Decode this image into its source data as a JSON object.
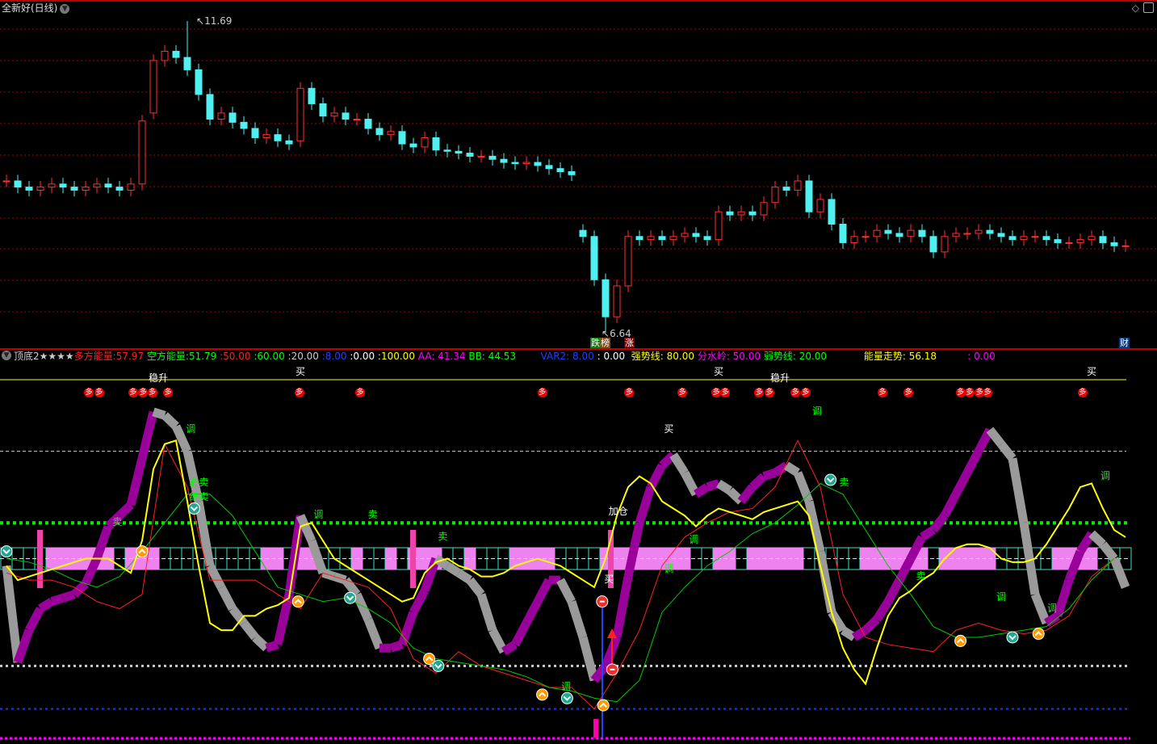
{
  "window": {
    "title": "全新好(日线)",
    "icons": [
      "chevron-down-icon",
      "diamond-icon",
      "panel-toggle-icon"
    ]
  },
  "price_panel": {
    "max_label": "11.69",
    "min_label": "6.64",
    "badges": [
      {
        "text": "跌",
        "color": "#1a7a1a"
      },
      {
        "text": "榜",
        "color": "#8a4a10"
      },
      {
        "text": "涨",
        "color": "#7a0000"
      }
    ],
    "fin_badge": "财"
  },
  "indicator_header": {
    "name": "顶底2★★★★",
    "items": [
      {
        "text": "多方能量:",
        "color": "#ff2020"
      },
      {
        "text": "57.97",
        "color": "#ff2020"
      },
      {
        "text": " 空方能量:",
        "color": "#00ff00"
      },
      {
        "text": "51.79",
        "color": "#00ff00"
      },
      {
        "text": " :50.00",
        "color": "#ff2020"
      },
      {
        "text": " :60.00",
        "color": "#00ff00"
      },
      {
        "text": " :20.00",
        "color": "#cccccc"
      },
      {
        "text": " :8.00",
        "color": "#2040ff"
      },
      {
        "text": " :0.00",
        "color": "#ffffff"
      },
      {
        "text": " :100.00",
        "color": "#ffff00"
      },
      {
        "text": " AA: 41.34",
        "color": "#ff00ff"
      },
      {
        "text": " BB: 44.53",
        "color": "#00ff00"
      },
      {
        "text": "        VAR2: 8.00",
        "color": "#2040ff"
      },
      {
        "text": " : 0.00",
        "color": "#ffffff"
      },
      {
        "text": "  强势线: 80.00",
        "color": "#ffff00"
      },
      {
        "text": " 分水岭: 50.00",
        "color": "#ff00ff"
      },
      {
        "text": " 弱势线: 20.00",
        "color": "#00ff00"
      },
      {
        "text": "            能量走势: 56.18",
        "color": "#ffff00"
      },
      {
        "text": "          : 0.00",
        "color": "#ff00ff"
      }
    ]
  },
  "signals": {
    "top_labels": [
      {
        "text": "稳升",
        "i": 13
      },
      {
        "text": "买",
        "i": 26
      },
      {
        "text": "买",
        "i": 63
      },
      {
        "text": "稳升",
        "i": 68
      },
      {
        "text": "买",
        "i": 96
      }
    ],
    "duo_label": "多",
    "duo_positions": [
      7.3,
      8.2,
      11.2,
      12.1,
      12.9,
      14.3,
      25.9,
      31.3,
      47.4,
      55.1,
      59.8,
      62.8,
      63.6,
      66.6,
      67.5,
      69.8,
      70.7,
      77.5,
      79.8,
      84.4,
      85.2,
      86.1,
      86.8,
      95.2
    ],
    "text_labels": [
      {
        "text": "调",
        "i": 16.3,
        "v": 86,
        "color": "#00ff00"
      },
      {
        "text": "必卖",
        "i": 16.6,
        "v": 71,
        "color": "#00ff00"
      },
      {
        "text": "绝卖",
        "i": 16.6,
        "v": 67,
        "color": "#00ff00"
      },
      {
        "text": "卖",
        "i": 9.8,
        "v": 60,
        "color": "#00ff00"
      },
      {
        "text": "调",
        "i": 27.6,
        "v": 62,
        "color": "#00ff00"
      },
      {
        "text": "卖",
        "i": 32.4,
        "v": 62,
        "color": "#00ff00"
      },
      {
        "text": "卖",
        "i": 38.6,
        "v": 56,
        "color": "#00ff00"
      },
      {
        "text": "买",
        "i": 58.6,
        "v": 86,
        "color": "#ffffff"
      },
      {
        "text": "加仓",
        "i": 53.7,
        "v": 63,
        "color": "#ffffff"
      },
      {
        "text": "买",
        "i": 53.3,
        "v": 44,
        "color": "#ffffff"
      },
      {
        "text": "调",
        "i": 60.8,
        "v": 55,
        "color": "#00ff00"
      },
      {
        "text": "调",
        "i": 58.6,
        "v": 47,
        "color": "#00ff00"
      },
      {
        "text": "调",
        "i": 71.7,
        "v": 91,
        "color": "#00ff00"
      },
      {
        "text": "卖",
        "i": 74.1,
        "v": 71,
        "color": "#00ff00"
      },
      {
        "text": "卖",
        "i": 80.9,
        "v": 45,
        "color": "#00ff00"
      },
      {
        "text": "调",
        "i": 88,
        "v": 39,
        "color": "#00ff00"
      },
      {
        "text": "调",
        "i": 92.5,
        "v": 36,
        "color": "#00ff00"
      },
      {
        "text": "调",
        "i": 97.2,
        "v": 73,
        "color": "#00ff00"
      },
      {
        "text": "调",
        "i": 49.5,
        "v": 14,
        "color": "#00ff00"
      }
    ]
  },
  "colors": {
    "up": "#ff3030",
    "down": "#50f0f0",
    "grid": "#b00000",
    "yellow": "#ffff00",
    "purple": "#9a009a",
    "gray": "#9a9a9a",
    "pink": "#ee82ee",
    "teal": "#40e0c0"
  },
  "chart_data": [
    {
      "type": "candlestick",
      "title": "全新好(日线)",
      "closes": [
        9.1,
        9.0,
        8.95,
        9.0,
        9.05,
        9.0,
        8.95,
        9.0,
        9.05,
        9.0,
        8.95,
        9.05,
        10.07,
        11.05,
        11.2,
        11.1,
        10.9,
        10.5,
        10.1,
        10.2,
        10.05,
        9.95,
        9.8,
        9.85,
        9.75,
        9.7,
        10.6,
        10.35,
        10.15,
        10.2,
        10.1,
        10.1,
        9.95,
        9.85,
        9.9,
        9.7,
        9.65,
        9.8,
        9.6,
        9.58,
        9.55,
        9.5,
        9.5,
        9.45,
        9.4,
        9.38,
        9.4,
        9.35,
        9.3,
        9.25,
        9.2,
        8.2,
        7.5,
        6.9,
        7.4,
        8.2,
        8.15,
        8.2,
        8.15,
        8.2,
        8.25,
        8.2,
        8.15,
        8.6,
        8.55,
        8.6,
        8.55,
        8.75,
        9.0,
        8.95,
        9.1,
        8.6,
        8.8,
        8.4,
        8.1,
        8.2,
        8.2,
        8.3,
        8.25,
        8.2,
        8.3,
        8.2,
        7.95,
        8.2,
        8.25,
        8.25,
        8.3,
        8.25,
        8.2,
        8.15,
        8.2,
        8.2,
        8.15,
        8.1,
        8.1,
        8.15,
        8.2,
        8.1,
        8.05,
        8.05
      ],
      "max": {
        "value": 11.69,
        "index": 16
      },
      "min": {
        "value": 6.64,
        "index": 53
      },
      "ylim": [
        6.5,
        11.85
      ]
    },
    {
      "type": "line",
      "title": "顶底2",
      "ylim": [
        0,
        100
      ],
      "reference_lines": [
        {
          "name": "强势线",
          "value": 80
        },
        {
          "name": "分水岭",
          "value": 60
        },
        {
          "name": "中线",
          "value": 50
        },
        {
          "name": "弱势线",
          "value": 20
        },
        {
          "name": "VAR2",
          "value": 8
        },
        {
          "name": "零线",
          "value": 0
        },
        {
          "name": "顶线",
          "value": 100
        }
      ],
      "series": [
        {
          "name": "能量走势",
          "color": "#ffff00",
          "values": [
            48,
            44,
            45,
            46,
            47,
            48,
            49,
            50,
            50,
            50,
            48,
            46,
            55,
            75,
            82,
            83,
            66,
            48,
            32,
            30,
            30,
            34,
            34,
            36,
            37,
            39,
            59,
            60,
            55,
            50,
            48,
            46,
            44,
            42,
            40,
            38,
            39,
            46,
            49,
            50,
            48,
            47,
            45,
            45,
            46,
            48,
            49,
            50,
            49,
            48,
            46,
            44,
            42,
            50,
            62,
            70,
            73,
            71,
            66,
            64,
            62,
            59,
            62,
            64,
            63,
            62,
            61,
            63,
            64,
            65,
            66,
            62,
            48,
            35,
            25,
            19,
            15,
            25,
            34,
            39,
            41,
            44,
            46,
            50,
            53,
            54,
            54,
            53,
            50,
            49,
            49,
            50,
            54,
            59,
            64,
            70,
            71,
            64,
            58,
            56
          ]
        },
        {
          "name": "多空带",
          "color": "#9a9a9a",
          "values": [
            48,
            21,
            30,
            36,
            38,
            39,
            40,
            43,
            50,
            59,
            62,
            65,
            78,
            91,
            90,
            87,
            80,
            66,
            48,
            42,
            36,
            32,
            28,
            25,
            26,
            40,
            62,
            55,
            46,
            45,
            44,
            40,
            33,
            25,
            25,
            26,
            35,
            41,
            50,
            48,
            46,
            44,
            40,
            30,
            24,
            26,
            32,
            38,
            44,
            44,
            38,
            28,
            16,
            20,
            28,
            45,
            60,
            70,
            76,
            79,
            74,
            68,
            70,
            71,
            69,
            66,
            70,
            73,
            74,
            76,
            74,
            66,
            52,
            35,
            30,
            28,
            30,
            33,
            38,
            44,
            50,
            56,
            58,
            62,
            68,
            74,
            80,
            86,
            82,
            78,
            60,
            40,
            32,
            34,
            44,
            52,
            57,
            54,
            50,
            42
          ]
        },
        {
          "name": "AA",
          "color": "#ff2020",
          "step": 2,
          "values": [
            46,
            44,
            44,
            42,
            38,
            36,
            40,
            82,
            70,
            44,
            44,
            44,
            40,
            36,
            46,
            44,
            42,
            36,
            22,
            18,
            24,
            20,
            18,
            16,
            14,
            14,
            8,
            18,
            30,
            48,
            56,
            60,
            63,
            64,
            70,
            83,
            70,
            40,
            28,
            26,
            25,
            24,
            30,
            32,
            30,
            29,
            30,
            34,
            45,
            50
          ]
        },
        {
          "name": "BB",
          "color": "#00cc00",
          "step": 2,
          "values": [
            50,
            49,
            47,
            44,
            42,
            45,
            52,
            60,
            68,
            68,
            62,
            52,
            42,
            40,
            38,
            39,
            36,
            32,
            25,
            22,
            21,
            20,
            19,
            17,
            14,
            13,
            11,
            10,
            16,
            35,
            42,
            48,
            52,
            57,
            60,
            65,
            71,
            68,
            58,
            48,
            40,
            31,
            28,
            28,
            29,
            30,
            31,
            36,
            44,
            50
          ]
        }
      ],
      "band_active_ranges": [
        [
          4,
          5
        ],
        [
          6,
          6
        ],
        [
          7,
          9
        ],
        [
          11,
          11
        ],
        [
          12,
          13
        ],
        [
          23,
          24
        ],
        [
          26,
          27
        ],
        [
          31,
          31
        ],
        [
          34,
          34
        ],
        [
          36,
          38
        ],
        [
          41,
          41
        ],
        [
          45,
          48
        ],
        [
          53,
          60
        ],
        [
          63,
          64
        ],
        [
          66,
          68
        ],
        [
          69,
          70
        ],
        [
          76,
          81
        ],
        [
          83,
          87
        ],
        [
          93,
          96
        ]
      ],
      "alert_bars": [
        3,
        36,
        53.5
      ],
      "sell_markers": [
        {
          "i": 0,
          "v": 52
        },
        {
          "i": 16.6,
          "v": 64
        },
        {
          "i": 30.4,
          "v": 39
        },
        {
          "i": 38.2,
          "v": 20
        },
        {
          "i": 49.6,
          "v": 11
        },
        {
          "i": 72.9,
          "v": 72
        },
        {
          "i": 89,
          "v": 28
        }
      ],
      "buy_markers": [
        {
          "i": 12,
          "v": 52
        },
        {
          "i": 25.8,
          "v": 38
        },
        {
          "i": 37.4,
          "v": 22
        },
        {
          "i": 47.4,
          "v": 12
        },
        {
          "i": 52.8,
          "v": 9
        },
        {
          "i": 84.4,
          "v": 27
        },
        {
          "i": 91.3,
          "v": 29
        }
      ],
      "red_markers": [
        {
          "i": 52.7,
          "v": 38
        },
        {
          "i": 53.6,
          "v": 19
        }
      ]
    }
  ]
}
